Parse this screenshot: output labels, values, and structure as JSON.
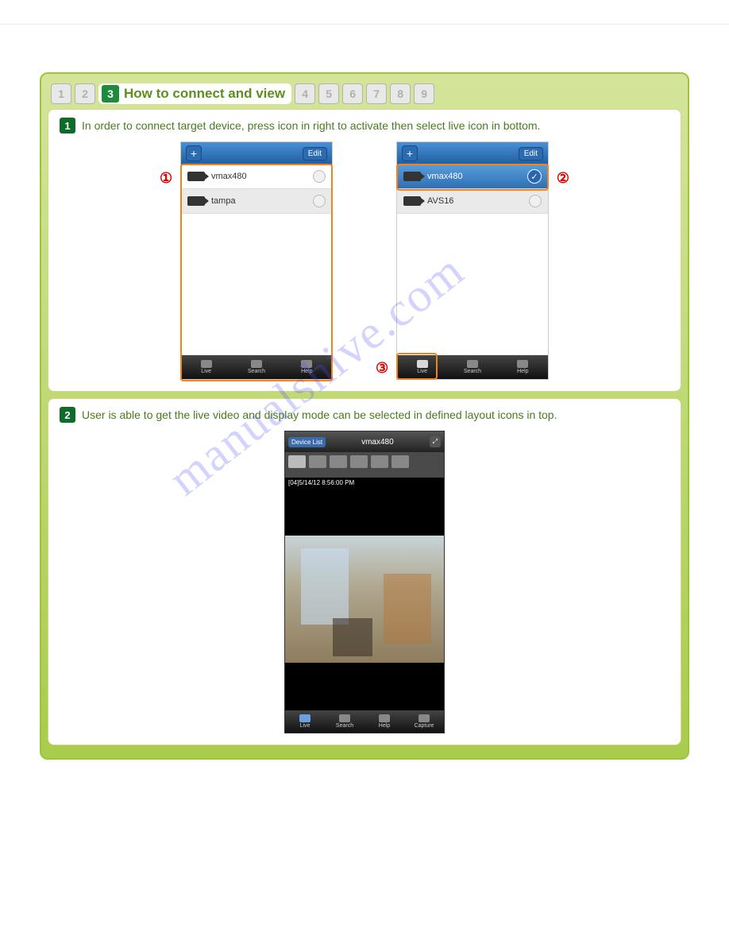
{
  "tabs": {
    "nums_before": [
      "1",
      "2"
    ],
    "active_num": "3",
    "active_title": "How to connect and view",
    "nums_after": [
      "4",
      "5",
      "6",
      "7",
      "8",
      "9"
    ]
  },
  "step1": {
    "badge": "1",
    "text": "In order to connect target device, press icon in right to activate then select live icon in bottom.",
    "phoneA": {
      "edit": "Edit",
      "plus": "+",
      "devices": [
        {
          "name": "vmax480"
        },
        {
          "name": "tampa"
        }
      ],
      "footer": [
        "Live",
        "Search",
        "Help"
      ]
    },
    "phoneB": {
      "edit": "Edit",
      "plus": "+",
      "devices": [
        {
          "name": "vmax480",
          "selected": true
        },
        {
          "name": "AVS16"
        }
      ],
      "footer": [
        "Live",
        "Search",
        "Help"
      ]
    },
    "callouts": {
      "c1": "①",
      "c2": "②",
      "c3": "③"
    }
  },
  "step2": {
    "badge": "2",
    "text": "User is able to get the live video and display mode can be selected in defined layout icons in top.",
    "live": {
      "back": "Device List",
      "title": "vmax480",
      "timestamp": "[04]5/14/12 8:56:00 PM",
      "footer": [
        "Live",
        "Search",
        "Help",
        "Capture"
      ]
    }
  },
  "watermark": "manualshive.com"
}
